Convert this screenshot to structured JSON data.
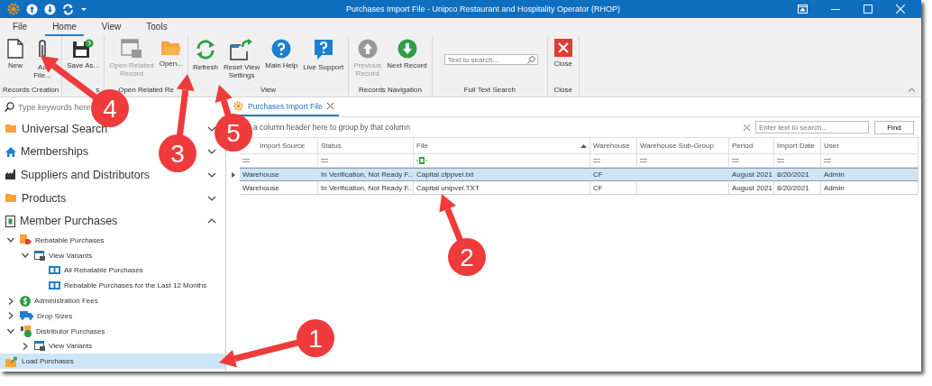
{
  "window": {
    "title": "Purchases Import File - Unipco Restaurant and Hospitality Operator (RHOP)"
  },
  "menu_tabs": [
    {
      "label": "File",
      "selected": false
    },
    {
      "label": "Home",
      "selected": true
    },
    {
      "label": "View",
      "selected": false
    },
    {
      "label": "Tools",
      "selected": false
    }
  ],
  "ribbon_groups": [
    {
      "label": "Records Creation",
      "buttons": [
        {
          "lines": [
            "New"
          ],
          "disabled": false
        },
        {
          "lines": [
            "Ad",
            "File..."
          ],
          "disabled": false
        }
      ]
    },
    {
      "label": "s",
      "buttons": [
        {
          "lines": [
            "Save As..."
          ],
          "disabled": false
        }
      ]
    },
    {
      "label": "Open Related Re",
      "buttons": [
        {
          "lines": [
            "Open Related",
            "Record"
          ],
          "disabled": true
        },
        {
          "lines": [
            "Open..."
          ],
          "disabled": false
        }
      ]
    },
    {
      "label": "View",
      "buttons": [
        {
          "lines": [
            "Refresh"
          ],
          "disabled": false
        },
        {
          "lines": [
            "Reset View",
            "Settings"
          ],
          "disabled": false
        },
        {
          "lines": [
            "Main Help"
          ],
          "disabled": false
        },
        {
          "lines": [
            "Live Support"
          ],
          "disabled": false
        }
      ]
    },
    {
      "label": "Records Navigation",
      "buttons": [
        {
          "lines": [
            "Previous",
            "Record"
          ],
          "disabled": true
        },
        {
          "lines": [
            "Next Record"
          ],
          "disabled": false
        }
      ]
    },
    {
      "label": "Full Text Search",
      "search": {
        "placeholder": "Text to search..."
      }
    },
    {
      "label": "Close",
      "buttons": [
        {
          "lines": [
            "Close"
          ],
          "disabled": false
        }
      ]
    }
  ],
  "nav": {
    "search": {
      "placeholder": "Type keywords here"
    },
    "sections": [
      {
        "label": "Universal Search",
        "expanded": false
      },
      {
        "label": "Memberships",
        "expanded": false
      },
      {
        "label": "Suppliers and Distributors",
        "expanded": false
      },
      {
        "label": "Products",
        "expanded": false
      },
      {
        "label": "Member Purchases",
        "expanded": true,
        "children": [
          {
            "label": "Rebatable Purchases",
            "expanded": true,
            "selected": false,
            "children": [
              {
                "label": "View Variants",
                "expanded": true,
                "selected": false,
                "children": [
                  {
                    "label": "All Rebatable Purchases",
                    "selected": false
                  },
                  {
                    "label": "Rebatable Purchases for the Last 12 Months",
                    "selected": false
                  }
                ]
              }
            ]
          },
          {
            "label": "Administration Fees",
            "expanded": false,
            "selected": false
          },
          {
            "label": "Drop Sizes",
            "expanded": false,
            "selected": false
          },
          {
            "label": "Distributor Purchases",
            "expanded": true,
            "selected": false,
            "children": [
              {
                "label": "View Variants",
                "expanded": false,
                "selected": false
              }
            ]
          }
        ]
      }
    ],
    "bottom_item": {
      "label": "Load Purchases",
      "selected": true
    }
  },
  "document_tab": {
    "label": "Purchases Import File"
  },
  "grid": {
    "group_panel": "a column header here to group by that column",
    "search": {
      "placeholder": "Enter text to search..."
    },
    "find_button": "Find",
    "columns": [
      {
        "label": "Import Source",
        "sorted": false
      },
      {
        "label": "Status",
        "sorted": false
      },
      {
        "label": "File",
        "sorted": true
      },
      {
        "label": "Warehouse",
        "sorted": false
      },
      {
        "label": "Warehouse Sub-Group",
        "sorted": false
      },
      {
        "label": "Period",
        "sorted": false
      },
      {
        "label": "Import Date",
        "sorted": false
      },
      {
        "label": "User",
        "sorted": false
      }
    ],
    "rows": [
      {
        "selected": true,
        "cells": [
          "Warehouse",
          "In Verification, Not Ready F...",
          "Capital cfppvel.txt",
          "CF",
          "",
          "August 2021",
          "8/20/2021",
          "Admin"
        ]
      },
      {
        "selected": false,
        "cells": [
          "Warehouse",
          "In Verification, Not Ready F...",
          "Capital unipvel.TXT",
          "CF",
          "",
          "August 2021",
          "8/20/2021",
          "Admin"
        ]
      }
    ]
  },
  "callouts": [
    {
      "number": "1"
    },
    {
      "number": "2"
    },
    {
      "number": "3"
    },
    {
      "number": "4"
    },
    {
      "number": "5"
    }
  ]
}
